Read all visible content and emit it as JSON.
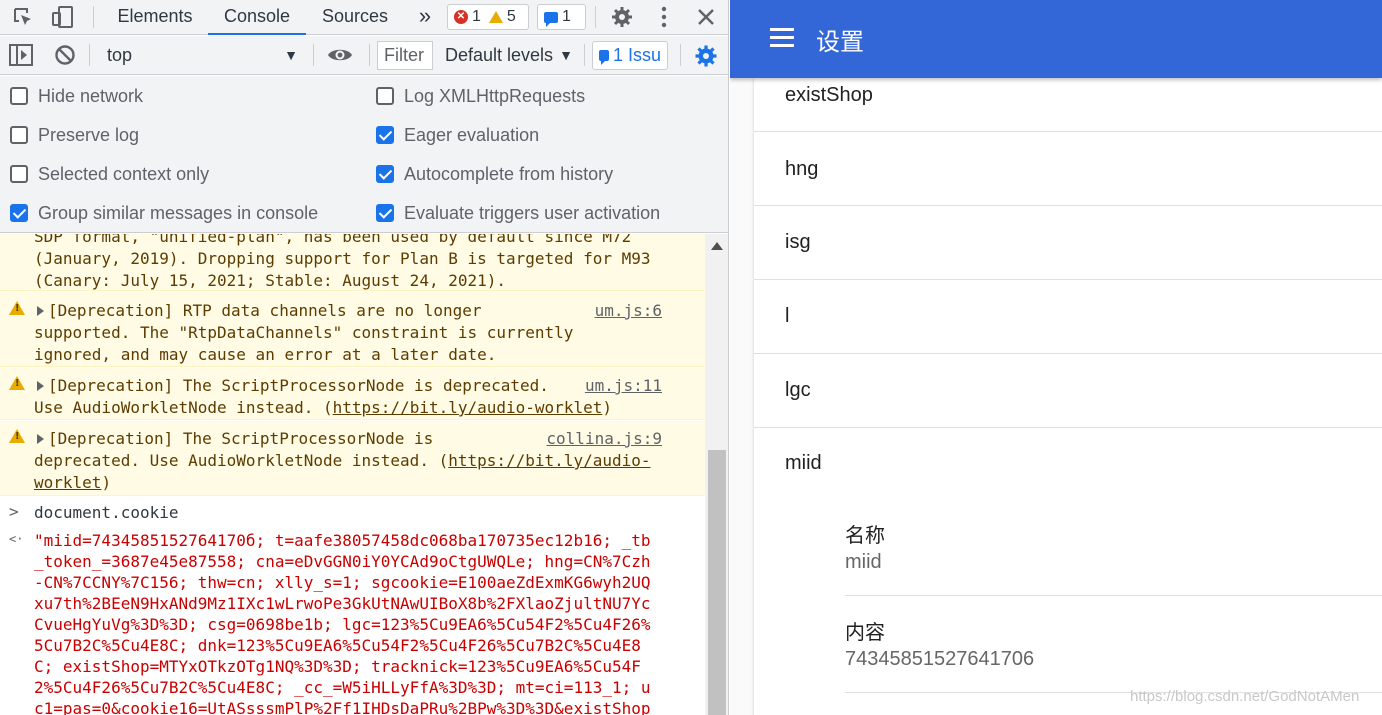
{
  "devtools": {
    "tabs": [
      "Elements",
      "Console",
      "Sources"
    ],
    "active_tab": "Console",
    "more_tabs": "»",
    "counters": {
      "errors": "1",
      "warnings": "5",
      "messages": "1"
    },
    "context": "top",
    "filter_placeholder": "Filter",
    "levels": "Default levels",
    "issues": "1 Issu",
    "settings": {
      "left": [
        {
          "label": "Hide network",
          "checked": false
        },
        {
          "label": "Preserve log",
          "checked": false
        },
        {
          "label": "Selected context only",
          "checked": false
        },
        {
          "label": "Group similar messages in console",
          "checked": true
        }
      ],
      "right": [
        {
          "label": "Log XMLHttpRequests",
          "checked": false
        },
        {
          "label": "Eager evaluation",
          "checked": true
        },
        {
          "label": "Autocomplete from history",
          "checked": true
        },
        {
          "label": "Evaluate triggers user activation",
          "checked": true
        }
      ]
    },
    "console": {
      "partial_warning": [
        "SDP format, \"unified-plan\", has been used by default since M72",
        "(January, 2019). Dropping support for Plan B is targeted for M93",
        "(Canary: July 15, 2021; Stable: August 24, 2021)."
      ],
      "warnings": [
        {
          "lines": [
            "[Deprecation] RTP data channels are no longer",
            "supported. The \"RtpDataChannels\" constraint is currently",
            "ignored, and may cause an error at a later date."
          ],
          "source": "um.js:6"
        },
        {
          "line1": "[Deprecation] The ScriptProcessorNode is deprecated.",
          "line2_pre": "Use AudioWorkletNode instead. (",
          "line2_link": "https://bit.ly/audio-worklet",
          "line2_post": ")",
          "source": "um.js:11"
        },
        {
          "line1": "[Deprecation] The ScriptProcessorNode is",
          "line2_pre": "deprecated. Use AudioWorkletNode instead. (",
          "line2_link": "https://bit.ly/audio-",
          "line3_link": "worklet",
          "line3_post": ")",
          "source": "collina.js:9"
        }
      ],
      "prompt_chevron": ">",
      "result_chevron": "<·",
      "command": "document.cookie",
      "result_lines": [
        "\"miid=7434585152764170б; t=aafe38057458dc068ba170735ec12b16; _tb",
        "_token_=3687e45e87558; cna=eDvGGN0iY0YCAd9oCtgUWQLe; hng=CN%7Czh",
        "-CN%7CCNY%7C156; thw=cn; xlly_s=1; sgcookie=E100aeZdExmKG6wyh2UQ",
        "xu7th%2BEeN9HxANd9Mz1IXc1wLrwoPe3GkUtNAwUIBoX8b%2FXlaoZjultNU7Yc",
        "CvueHgYuVg%3D%3D; csg=0698be1b; lgc=123%5Cu9EA6%5Cu54F2%5Cu4F26%",
        "5Cu7B2C%5Cu4E8C; dnk=123%5Cu9EA6%5Cu54F2%5Cu4F26%5Cu7B2C%5Cu4E8",
        "C; existShop=MTYxOTkzOTg1NQ%3D%3D; tracknick=123%5Cu9EA6%5Cu54F",
        "2%5Cu4F26%5Cu7B2C%5Cu4E8C; _cc_=W5iHLLyFfA%3D%3D; mt=ci=113_1; u",
        "c1=pas=0&cookie16=UtASsssmPlP%2Ff1IHDsDaPRu%2BPw%3D%3D&existShop"
      ]
    }
  },
  "app": {
    "title": "设置",
    "rows": [
      "existShop",
      "hng",
      "isg",
      "l",
      "lgc",
      "miid"
    ],
    "details": [
      {
        "label": "名称",
        "value": "miid"
      },
      {
        "label": "内容",
        "value": "74345851527641706"
      }
    ],
    "watermark": "https://blog.csdn.net/GodNotAMen"
  }
}
